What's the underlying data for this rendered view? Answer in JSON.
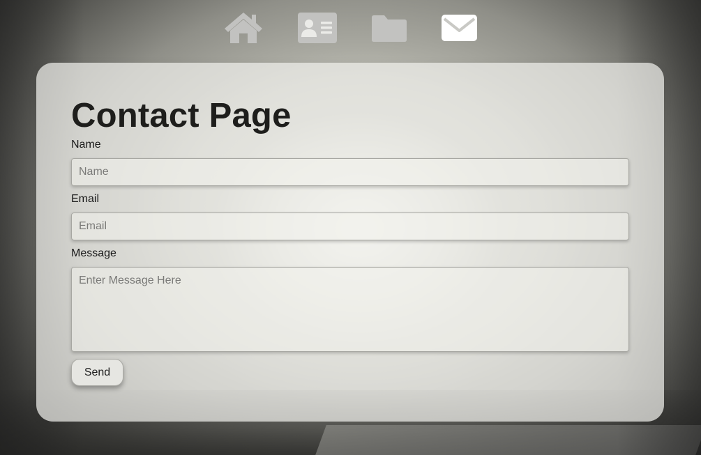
{
  "nav": {
    "items": [
      {
        "icon": "home-icon"
      },
      {
        "icon": "id-card-icon"
      },
      {
        "icon": "folder-icon"
      },
      {
        "icon": "envelope-icon",
        "active": true
      }
    ],
    "colors": {
      "inactive": "#c2c2c0",
      "active": "#ffffff"
    }
  },
  "contact": {
    "title": "Contact Page",
    "name_label": "Name",
    "name_placeholder": "Name",
    "email_label": "Email",
    "email_placeholder": "Email",
    "message_label": "Message",
    "message_placeholder": "Enter Message Here",
    "send_label": "Send"
  }
}
